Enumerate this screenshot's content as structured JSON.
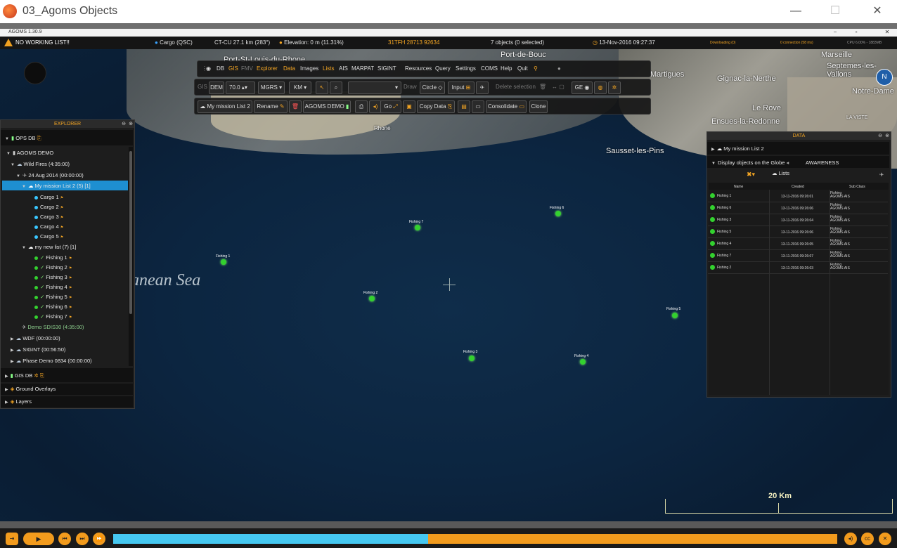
{
  "window": {
    "title": "03_Agoms Objects",
    "minimize": "—",
    "maximize": "☐",
    "close": "✕"
  },
  "app": {
    "title": "AGOMS 1.30.9",
    "min": "−",
    "max": "▫",
    "close": "✕"
  },
  "status": {
    "warning": "NO WORKING LIST!!",
    "cargo": "Cargo (QSC)",
    "ctcu": "CT-CU 27.1 km (283°)",
    "elevation": "Elevation: 0 m (11.31%)",
    "grid": "31TFH 28713 92634",
    "objects": "7 objects (0 selected)",
    "datetime": "13-Nov-2016 09:27:37",
    "downloading": "Downloading (0)",
    "connection": "0 connection (58 ms)",
    "cpu": "CPU 6.00% - 1883MB"
  },
  "toolbar1": {
    "db": "DB",
    "gis": "GIS",
    "fmv": "FMV",
    "explorer": "Explorer",
    "data": "Data",
    "images": "Images",
    "lists": "Lists",
    "ais": "AIS",
    "marpat": "MARPAT",
    "sigint": "SIGINT",
    "resources": "Resources",
    "query": "Query",
    "settings": "Settings",
    "coms": "COMS",
    "help": "Help",
    "quit": "Quit"
  },
  "toolbar2": {
    "gis": "GIS",
    "dem": "DEM",
    "dem_value": "70.0",
    "mgrs": "MGRS",
    "km": "KM",
    "draw": "Draw",
    "circle": "Circle",
    "input": "Input",
    "delete_selection": "Delete selection",
    "ge": "GE"
  },
  "toolbar3": {
    "list": "My mission List 2",
    "rename": "Rename",
    "agoms_demo": "AGOMS DEMO",
    "go": "Go",
    "copy_data": "Copy Data",
    "consolidate": "Consolidate",
    "clone": "Clone"
  },
  "map": {
    "sea_label": "anean Sea",
    "places": [
      "Port-St-Louis-du-Rhone",
      "Port-de-Bouc",
      "Martigues",
      "Gignac-la-Nerthe",
      "Le Rove",
      "Ensues-la-Redonne",
      "Sausset-les-Pins",
      "Septemes-les-Vallons",
      "Notre-Dame",
      "Marseille",
      "Rhone",
      "LA VISTE"
    ],
    "objects": [
      {
        "name": "Fishing 1"
      },
      {
        "name": "Fishing 7"
      },
      {
        "name": "Fishing 6"
      },
      {
        "name": "Fishing 2"
      },
      {
        "name": "Fishing 5"
      },
      {
        "name": "Fishing 3"
      },
      {
        "name": "Fishing 4"
      }
    ],
    "scale": "20 Km"
  },
  "explorer": {
    "title": "EXPLORER",
    "ops_db": "OPS DB",
    "agoms_demo": "AGOMS DEMO",
    "wild_fires": "Wild Fires (4:35:00)",
    "date_node": "24 Aug 2014 (00:00:00)",
    "mission_list": "My mission List 2 (5) [1]",
    "cargo": [
      "Cargo 1",
      "Cargo 2",
      "Cargo 3",
      "Cargo 4",
      "Cargo 5"
    ],
    "new_list": "my new list (7) [1]",
    "fishing": [
      "Fishing 1",
      "Fishing 2",
      "Fishing 3",
      "Fishing 4",
      "Fishing 5",
      "Fishing 6",
      "Fishing 7"
    ],
    "demo_sdis": "Demo SDIS30 (4:35:00)",
    "wdf": "WDF (00:00:00)",
    "sigint": "SIGINT (00:56:50)",
    "phase_demo": "Phase Demo 0834 (00:00:00)",
    "gis_db": "GIS DB",
    "ground_overlays": "Ground Overlays",
    "layers": "Layers"
  },
  "datapanel": {
    "title": "DATA",
    "list": "My mission List 2",
    "display": "Display objects on the Globe",
    "awareness": "AWARENESS",
    "lists_tab": "Lists",
    "columns": [
      "Name",
      "Created",
      "Sub Class"
    ],
    "rows": [
      {
        "name": "Fishing 1",
        "created": "13-11-2016 09:26:01",
        "sub": "Fishing AGOMS AIS"
      },
      {
        "name": "Fishing 6",
        "created": "13-11-2016 09:26:06",
        "sub": "Fishing AGOMS AIS"
      },
      {
        "name": "Fishing 3",
        "created": "13-11-2016 09:26:04",
        "sub": "Fishing AGOMS AIS"
      },
      {
        "name": "Fishing 5",
        "created": "13-11-2016 09:26:06",
        "sub": "Fishing AGOMS AIS"
      },
      {
        "name": "Fishing 4",
        "created": "13-11-2016 09:26:05",
        "sub": "Fishing AGOMS AIS"
      },
      {
        "name": "Fishing 7",
        "created": "13-11-2016 09:26:07",
        "sub": "Fishing AGOMS AIS"
      },
      {
        "name": "Fishing 2",
        "created": "13-11-2016 09:26:03",
        "sub": "Fishing AGOMS AIS"
      }
    ]
  },
  "timeline": {
    "progress": 0.435
  }
}
